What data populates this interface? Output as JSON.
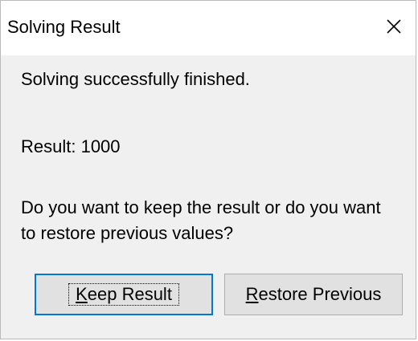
{
  "window": {
    "title": "Solving Result",
    "close_icon": "close-icon"
  },
  "messages": {
    "status": "Solving successfully finished.",
    "result": "Result: 1000",
    "question": "Do you want to keep the result or do you want to restore previous values?"
  },
  "buttons": {
    "keep": {
      "accesskey": "K",
      "rest": "eep Result"
    },
    "restore": {
      "accesskey": "R",
      "rest": "estore Previous"
    }
  },
  "colors": {
    "focus_border": "#0078d7",
    "dialog_background": "#f0f0f0",
    "button_background": "#e1e1e1"
  }
}
